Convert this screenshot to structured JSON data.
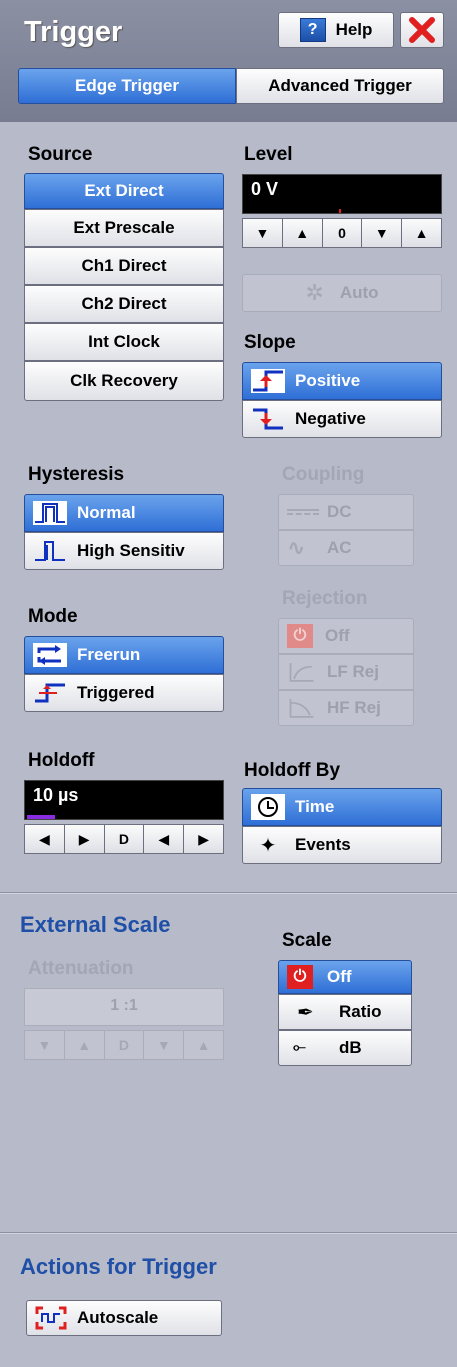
{
  "header": {
    "title": "Trigger",
    "help_label": "Help",
    "tabs": [
      "Edge Trigger",
      "Advanced Trigger"
    ]
  },
  "source": {
    "label": "Source",
    "options": [
      "Ext Direct",
      "Ext Prescale",
      "Ch1 Direct",
      "Ch2 Direct",
      "Int Clock",
      "Clk Recovery"
    ],
    "selected": "Ext Direct"
  },
  "level": {
    "label": "Level",
    "value": "0 V",
    "spin": [
      "▼",
      "▲",
      "0",
      "▼",
      "▲"
    ],
    "auto_label": "Auto"
  },
  "slope": {
    "label": "Slope",
    "options": [
      "Positive",
      "Negative"
    ],
    "selected": "Positive"
  },
  "hysteresis": {
    "label": "Hysteresis",
    "options": [
      "Normal",
      "High Sensitiv"
    ],
    "selected": "Normal"
  },
  "coupling": {
    "label": "Coupling",
    "options": [
      "DC",
      "AC"
    ]
  },
  "mode": {
    "label": "Mode",
    "options": [
      "Freerun",
      "Triggered"
    ],
    "selected": "Freerun"
  },
  "rejection": {
    "label": "Rejection",
    "options": [
      "Off",
      "LF Rej",
      "HF Rej"
    ]
  },
  "holdoff": {
    "label": "Holdoff",
    "value": "10 µs",
    "spin": [
      "◀",
      "▶",
      "D",
      "◀",
      "▶"
    ]
  },
  "holdoff_by": {
    "label": "Holdoff By",
    "options": [
      "Time",
      "Events"
    ],
    "selected": "Time"
  },
  "external_scale": {
    "section_label": "External Scale",
    "attenuation_label": "Attenuation",
    "attenuation_value": "1 :1",
    "spin": [
      "▼",
      "▲",
      "D",
      "▼",
      "▲"
    ],
    "scale_label": "Scale",
    "scale_options": [
      "Off",
      "Ratio",
      "dB"
    ],
    "scale_selected": "Off"
  },
  "actions": {
    "section_label": "Actions for Trigger",
    "autoscale_label": "Autoscale"
  },
  "colors": {
    "selected_blue": "#2f6fd6",
    "section_blue": "#1f4fa6",
    "panel_bg": "#b6bac9",
    "close_red": "#e02020"
  }
}
